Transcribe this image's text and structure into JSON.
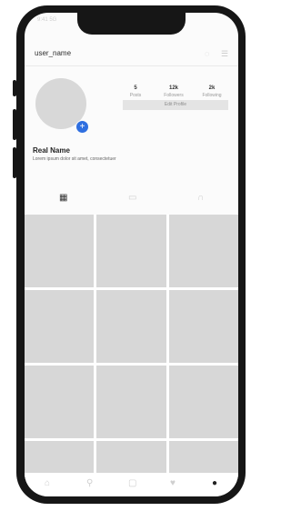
{
  "status_bar": {
    "time": "9:41 5G"
  },
  "header": {
    "username": "user_name"
  },
  "profile": {
    "real_name": "Real Name",
    "bio": "Lorem ipsum dolor sit amet, consectetuer",
    "stats": [
      {
        "value": "5",
        "label": "Posts"
      },
      {
        "value": "12k",
        "label": "Followers"
      },
      {
        "value": "2k",
        "label": "Following"
      }
    ],
    "edit_button_label": "Edit Profile"
  },
  "tabs": [
    {
      "icon": "grid-icon",
      "glyph": "▦"
    },
    {
      "icon": "reels-icon",
      "glyph": "▭"
    },
    {
      "icon": "tagged-icon",
      "glyph": "∩"
    }
  ],
  "posts_grid_count": 12,
  "bottom_nav": [
    {
      "icon": "home-icon",
      "glyph": "⌂"
    },
    {
      "icon": "search-icon",
      "glyph": "⚲"
    },
    {
      "icon": "add-post-icon",
      "glyph": "▢"
    },
    {
      "icon": "likes-icon",
      "glyph": "♥"
    },
    {
      "icon": "profile-icon",
      "glyph": "●"
    }
  ]
}
